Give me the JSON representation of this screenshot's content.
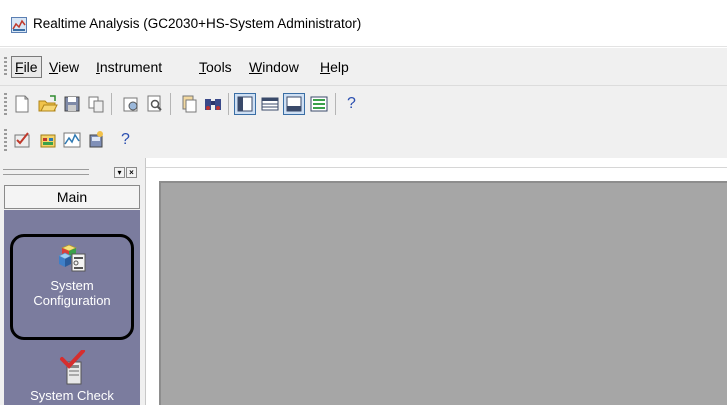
{
  "window": {
    "title": "Realtime Analysis (GC2030+HS-System Administrator)",
    "icon": "realtime-analysis-app-icon"
  },
  "menubar": {
    "items": [
      {
        "label": "File",
        "mnemonic": "F",
        "rest": "ile"
      },
      {
        "label": "View",
        "mnemonic": "V",
        "rest": "iew"
      },
      {
        "label": "Instrument",
        "mnemonic": "I",
        "rest": "nstrument"
      },
      {
        "label": "Tools",
        "mnemonic": "T",
        "rest": "ools"
      },
      {
        "label": "Window",
        "mnemonic": "W",
        "rest": "indow"
      },
      {
        "label": "Help",
        "mnemonic": "H",
        "rest": "elp"
      }
    ]
  },
  "toolbar1": {
    "buttons": [
      "new-icon",
      "open-icon",
      "save-icon",
      "copy-icon",
      "print-preview-setup-icon",
      "print-preview-icon",
      "data-file-icon",
      "binoculars-icon",
      "panel-view-icon",
      "table-view-icon",
      "chart-view-icon",
      "list-view-icon",
      "help-icon"
    ],
    "help_label": "?"
  },
  "toolbar2": {
    "buttons": [
      "check-report-icon",
      "batch-icon",
      "monitor-chart-icon",
      "instrument-icon",
      "help-icon"
    ],
    "help_label": "?"
  },
  "left_pane": {
    "pane_buttons": [
      "▾",
      "×"
    ],
    "tab_label": "Main",
    "items": [
      {
        "line1": "System",
        "line2": "Configuration",
        "icon": "system-configuration-icon",
        "selected": true
      },
      {
        "line1": "System Check",
        "icon": "system-check-icon",
        "selected": false
      }
    ]
  },
  "colors": {
    "nav_panel": "#7b7c9e",
    "workspace": "#a6a6a6",
    "chrome": "#f0f0f0"
  }
}
